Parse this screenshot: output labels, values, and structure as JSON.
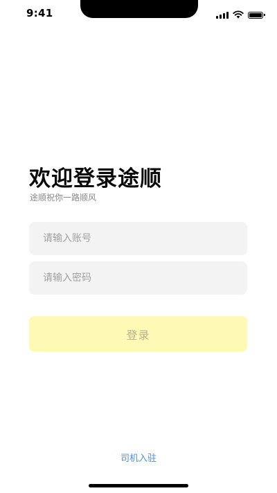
{
  "status_bar": {
    "time": "9:41",
    "icons": [
      "signal-icon",
      "wifi-icon",
      "battery-icon"
    ]
  },
  "header": {
    "title": "欢迎登录途顺",
    "subtitle": "途顺祝你一路顺风"
  },
  "form": {
    "account_placeholder": "请输入账号",
    "account_value": "",
    "password_placeholder": "请输入密码",
    "password_value": ""
  },
  "login_button": {
    "label": "登录",
    "background_color": "#fff9b6",
    "text_color": "#b7b38a"
  },
  "footer": {
    "driver_link": "司机入驻",
    "link_color": "#4a8fe0"
  }
}
